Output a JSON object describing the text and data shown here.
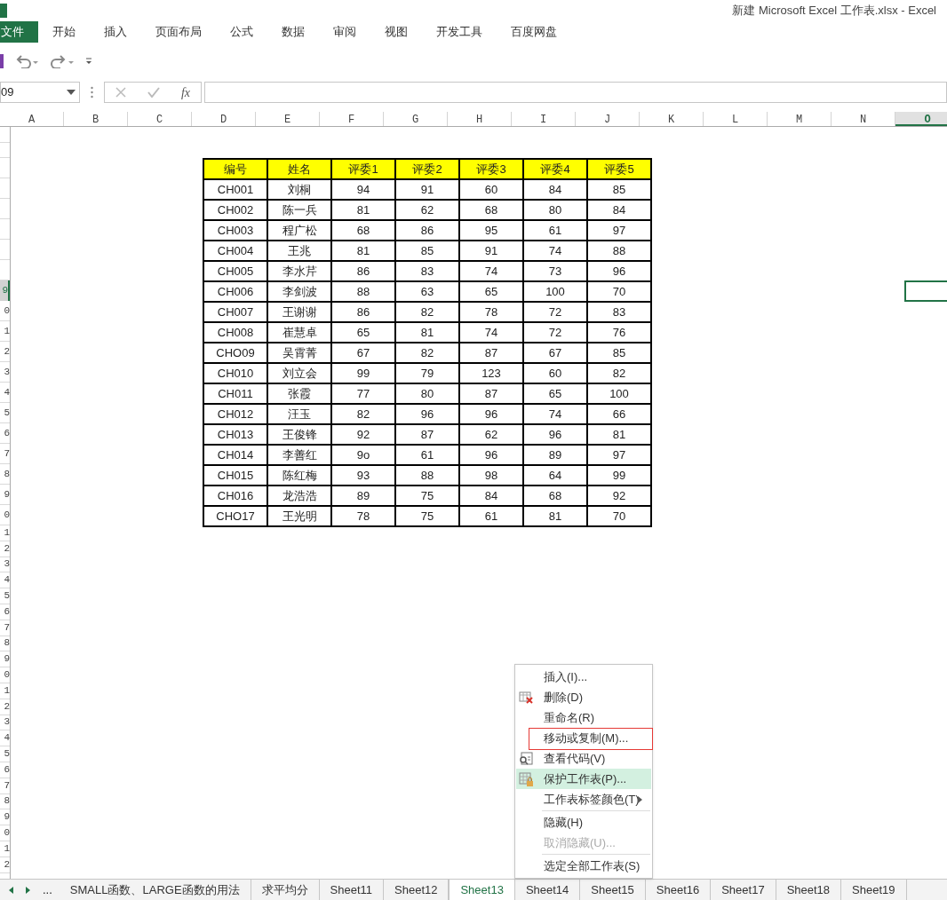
{
  "window": {
    "title": "新建 Microsoft Excel 工作表.xlsx - Excel"
  },
  "ribbon_tabs": [
    {
      "label": "文件",
      "selected": true
    },
    {
      "label": "开始",
      "selected": false
    },
    {
      "label": "插入",
      "selected": false
    },
    {
      "label": "页面布局",
      "selected": false
    },
    {
      "label": "公式",
      "selected": false
    },
    {
      "label": "数据",
      "selected": false
    },
    {
      "label": "审阅",
      "selected": false
    },
    {
      "label": "视图",
      "selected": false
    },
    {
      "label": "开发工具",
      "selected": false
    },
    {
      "label": "百度网盘",
      "selected": false
    }
  ],
  "name_box": {
    "value": "09"
  },
  "formula_bar": {
    "fx": "fx"
  },
  "column_headers": [
    {
      "label": "A",
      "selected": false
    },
    {
      "label": "B",
      "selected": false
    },
    {
      "label": "C",
      "selected": false
    },
    {
      "label": "D",
      "selected": false
    },
    {
      "label": "E",
      "selected": false
    },
    {
      "label": "F",
      "selected": false
    },
    {
      "label": "G",
      "selected": false
    },
    {
      "label": "H",
      "selected": false
    },
    {
      "label": "I",
      "selected": false
    },
    {
      "label": "J",
      "selected": false
    },
    {
      "label": "K",
      "selected": false
    },
    {
      "label": "L",
      "selected": false
    },
    {
      "label": "M",
      "selected": false
    },
    {
      "label": "N",
      "selected": false
    },
    {
      "label": "O",
      "selected": true
    }
  ],
  "row_headers": [
    {
      "label": "9",
      "selected": true
    },
    {
      "label": "0",
      "selected": false
    },
    {
      "label": "1",
      "selected": false
    },
    {
      "label": "2",
      "selected": false
    },
    {
      "label": "3",
      "selected": false
    },
    {
      "label": "4",
      "selected": false
    },
    {
      "label": "5",
      "selected": false
    },
    {
      "label": "6",
      "selected": false
    },
    {
      "label": "7",
      "selected": false
    },
    {
      "label": "8",
      "selected": false
    },
    {
      "label": "9",
      "selected": false
    },
    {
      "label": "0",
      "selected": false
    },
    {
      "label": "1",
      "selected": false
    },
    {
      "label": "2",
      "selected": false
    },
    {
      "label": "3",
      "selected": false
    },
    {
      "label": "4",
      "selected": false
    },
    {
      "label": "5",
      "selected": false
    },
    {
      "label": "6",
      "selected": false
    },
    {
      "label": "7",
      "selected": false
    },
    {
      "label": "8",
      "selected": false
    },
    {
      "label": "9",
      "selected": false
    },
    {
      "label": "0",
      "selected": false
    },
    {
      "label": "1",
      "selected": false
    },
    {
      "label": "2",
      "selected": false
    },
    {
      "label": "3",
      "selected": false
    },
    {
      "label": "4",
      "selected": false
    },
    {
      "label": "5",
      "selected": false
    },
    {
      "label": "6",
      "selected": false
    },
    {
      "label": "7",
      "selected": false
    },
    {
      "label": "8",
      "selected": false
    },
    {
      "label": "9",
      "selected": false
    },
    {
      "label": "0",
      "selected": false
    },
    {
      "label": "1",
      "selected": false
    },
    {
      "label": "2",
      "selected": false
    }
  ],
  "table": {
    "columns": [
      "编号",
      "姓名",
      "评委1",
      "评委2",
      "评委3",
      "评委4",
      "评委5"
    ],
    "rows": [
      [
        "CH001",
        "刘桐",
        "94",
        "91",
        "60",
        "84",
        "85"
      ],
      [
        "CH002",
        "陈一兵",
        "81",
        "62",
        "68",
        "80",
        "84"
      ],
      [
        "CH003",
        "程广松",
        "68",
        "86",
        "95",
        "61",
        "97"
      ],
      [
        "CH004",
        "王兆",
        "81",
        "85",
        "91",
        "74",
        "88"
      ],
      [
        "CH005",
        "李水芹",
        "86",
        "83",
        "74",
        "73",
        "96"
      ],
      [
        "CH006",
        "李剑波",
        "88",
        "63",
        "65",
        "100",
        "70"
      ],
      [
        "CH007",
        "王谢谢",
        "86",
        "82",
        "78",
        "72",
        "83"
      ],
      [
        "CH008",
        "崔慧卓",
        "65",
        "81",
        "74",
        "72",
        "76"
      ],
      [
        "CHO09",
        "吴霄菁",
        "67",
        "82",
        "87",
        "67",
        "85"
      ],
      [
        "CH010",
        "刘立会",
        "99",
        "79",
        "123",
        "60",
        "82"
      ],
      [
        "CH011",
        "张霞",
        "77",
        "80",
        "87",
        "65",
        "100"
      ],
      [
        "CH012",
        "汪玉",
        "82",
        "96",
        "96",
        "74",
        "66"
      ],
      [
        "CH013",
        "王俊锋",
        "92",
        "87",
        "62",
        "96",
        "81"
      ],
      [
        "CH014",
        "李善红",
        "9o",
        "61",
        "96",
        "89",
        "97"
      ],
      [
        "CH015",
        "陈红梅",
        "93",
        "88",
        "98",
        "64",
        "99"
      ],
      [
        "CH016",
        "龙浩浩",
        "89",
        "75",
        "84",
        "68",
        "92"
      ],
      [
        "CHO17",
        "王光明",
        "78",
        "75",
        "61",
        "81",
        "70"
      ]
    ]
  },
  "context_menu": {
    "items": [
      {
        "kind": "item",
        "label": "插入(I)...",
        "disabled": false,
        "highlighted": false,
        "outlined": false
      },
      {
        "kind": "icon_item",
        "label": "删除(D)",
        "disabled": false,
        "highlighted": false,
        "outlined": false
      },
      {
        "kind": "item",
        "label": "重命名(R)",
        "disabled": false,
        "highlighted": false,
        "outlined": false
      },
      {
        "kind": "item",
        "label": "移动或复制(M)...",
        "disabled": false,
        "highlighted": false,
        "outlined": true
      },
      {
        "kind": "icon_item",
        "label": "查看代码(V)",
        "disabled": false,
        "highlighted": false,
        "outlined": false
      },
      {
        "kind": "icon_item",
        "label": "保护工作表(P)...",
        "disabled": false,
        "highlighted": true,
        "outlined": false
      },
      {
        "kind": "item",
        "label": "工作表标签颜色(T)",
        "submenu": true,
        "disabled": false,
        "highlighted": false,
        "outlined": false
      },
      {
        "kind": "separator"
      },
      {
        "kind": "item",
        "label": "隐藏(H)",
        "disabled": false,
        "highlighted": false,
        "outlined": false
      },
      {
        "kind": "item",
        "label": "取消隐藏(U)...",
        "disabled": true,
        "highlighted": false,
        "outlined": false
      },
      {
        "kind": "separator"
      },
      {
        "kind": "item",
        "label": "选定全部工作表(S)",
        "disabled": false,
        "highlighted": false,
        "outlined": false
      }
    ]
  },
  "sheet_nav": {
    "more": "..."
  },
  "sheet_tabs": [
    {
      "label": "SMALL函数、LARGE函数的用法",
      "selected": false
    },
    {
      "label": "求平均分",
      "selected": false
    },
    {
      "label": "Sheet11",
      "selected": false
    },
    {
      "label": "Sheet12",
      "selected": false
    },
    {
      "label": "Sheet13",
      "selected": true
    },
    {
      "label": "Sheet14",
      "selected": false
    },
    {
      "label": "Sheet15",
      "selected": false
    },
    {
      "label": "Sheet16",
      "selected": false
    },
    {
      "label": "Sheet17",
      "selected": false
    },
    {
      "label": "Sheet18",
      "selected": false
    },
    {
      "label": "Sheet19",
      "selected": false
    }
  ]
}
